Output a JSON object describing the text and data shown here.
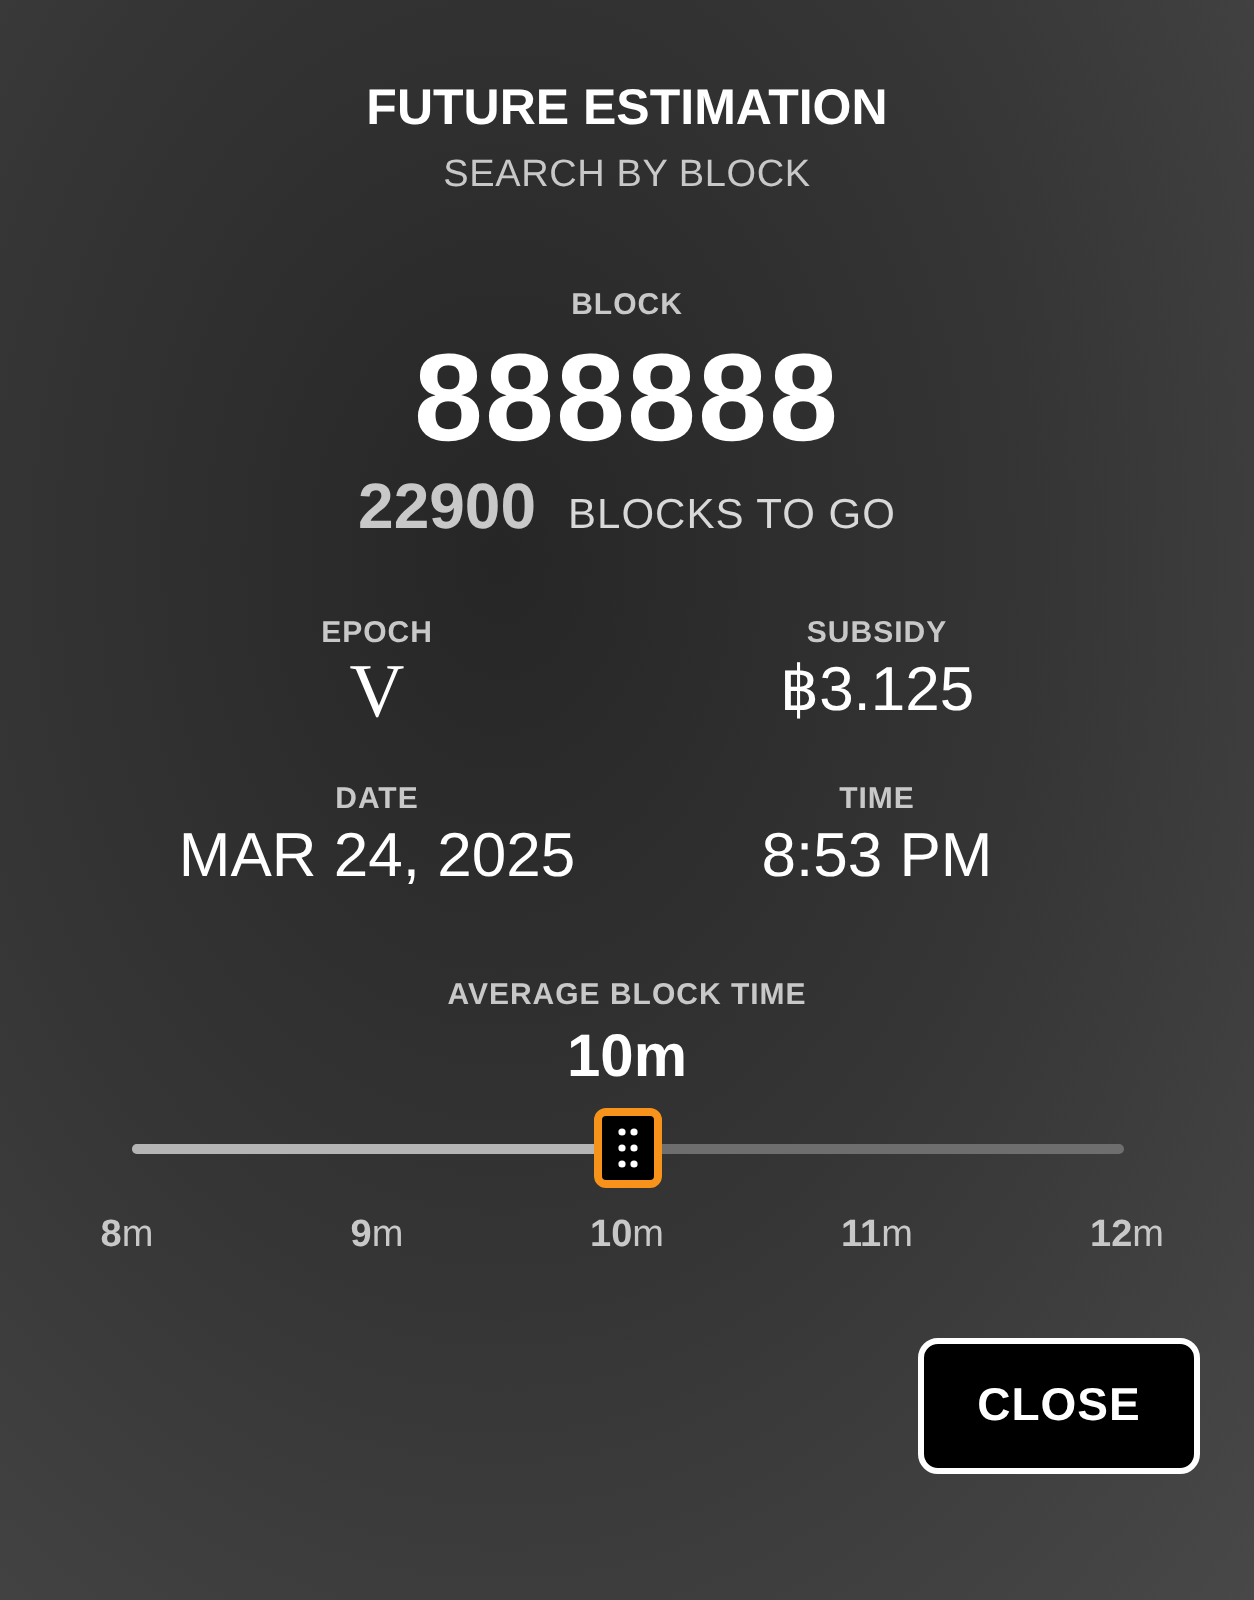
{
  "title": "FUTURE ESTIMATION",
  "subtitle": "SEARCH BY BLOCK",
  "block": {
    "label": "BLOCK",
    "value": "888888",
    "remaining": "22900",
    "remaining_label": "BLOCKS TO GO"
  },
  "stats": [
    {
      "label": "EPOCH",
      "value": "V",
      "kind": "roman"
    },
    {
      "label": "SUBSIDY",
      "value": "฿3.125",
      "kind": "plain"
    },
    {
      "label": "DATE",
      "value": "MAR 24, 2025",
      "kind": "plain"
    },
    {
      "label": "TIME",
      "value": "8:53 PM",
      "kind": "plain"
    }
  ],
  "average_block_time": {
    "label": "AVERAGE BLOCK TIME",
    "value": "10m",
    "level": 0.5,
    "ticks": [
      "**8**m",
      "**9**m",
      "**10**m",
      "**11**m",
      "**12**m"
    ]
  },
  "buttons": [
    "CLOSE"
  ]
}
